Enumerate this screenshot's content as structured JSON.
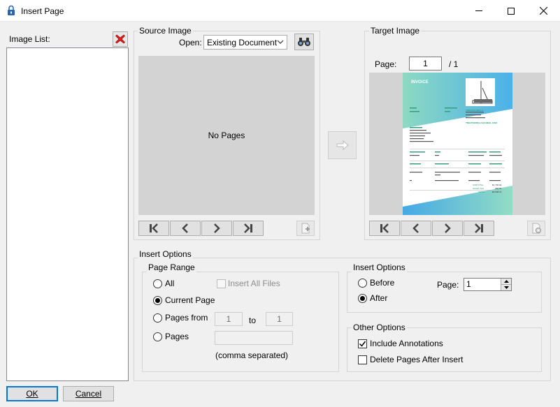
{
  "window": {
    "title": "Insert Page",
    "icon": "lock-icon"
  },
  "image_list": {
    "label": "Image List:",
    "remove_icon": "red-x-icon"
  },
  "source": {
    "group_label": "Source Image",
    "open_label": "Open:",
    "open_value": "Existing Document",
    "browse_icon": "binoculars-icon",
    "placeholder": "No Pages"
  },
  "target": {
    "group_label": "Target Image",
    "page_label": "Page:",
    "page_value": "1",
    "page_total": "/ 1"
  },
  "preview": {
    "heading": "INVOICE",
    "company": "TREATED WELLS",
    "email": "TREATEDWELLS@GMAIL.COM",
    "subtotal_label": "SUBTOTAL",
    "tax_label": "SALES TAX",
    "total_label": "TOTAL",
    "subtotal": "$7,760.00",
    "tax": "388.76",
    "total": "$8,098.76"
  },
  "insert_options": {
    "group_label": "Insert Options"
  },
  "page_range": {
    "label": "Page Range",
    "all": "All",
    "insert_all_files": "Insert All Files",
    "current_page": "Current Page",
    "pages_from": "Pages from",
    "from_value": "1",
    "to_label": "to",
    "to_value": "1",
    "pages": "Pages",
    "comma_note": "(comma separated)",
    "selected": "current_page"
  },
  "position": {
    "label": "Insert Options",
    "before": "Before",
    "after": "After",
    "page_label": "Page:",
    "page_value": "1",
    "selected": "after"
  },
  "other": {
    "label": "Other Options",
    "include_annotations": "Include Annotations",
    "include_annotations_checked": true,
    "delete_pages": "Delete Pages After Insert",
    "delete_pages_checked": false
  },
  "buttons": {
    "ok": "OK",
    "cancel": "Cancel"
  }
}
